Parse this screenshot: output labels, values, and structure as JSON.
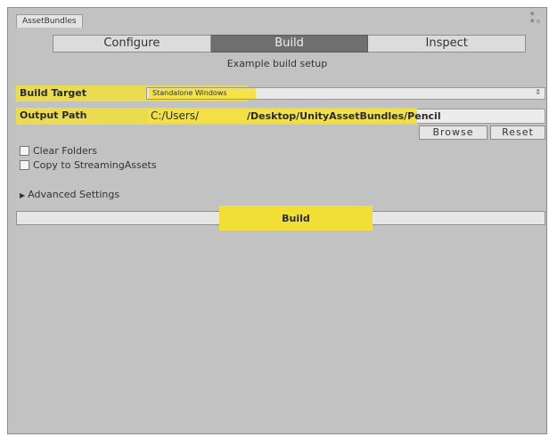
{
  "window": {
    "tab_title": "AssetBundles"
  },
  "toolbar": {
    "tabs": [
      "Configure",
      "Build",
      "Inspect"
    ],
    "active": "Build"
  },
  "subtitle": "Example build setup",
  "build_target": {
    "label": "Build Target",
    "value": "Standalone Windows"
  },
  "output_path": {
    "label": "Output Path",
    "prefix": "C:/Users/",
    "suffix": "/Desktop/UnityAssetBundles/Pencil"
  },
  "buttons": {
    "browse": "Browse",
    "reset": "Reset",
    "build": "Build"
  },
  "options": {
    "clear_folders": "Clear Folders",
    "copy_streaming": "Copy to StreamingAssets",
    "advanced": "Advanced Settings"
  },
  "colors": {
    "highlight": "#f2df35",
    "panel": "#c2c2c2",
    "active_tab": "#6f6f6f"
  },
  "icons": {
    "foldout": "triangle-right-icon",
    "dropdown": "dropdown-arrows-icon"
  }
}
